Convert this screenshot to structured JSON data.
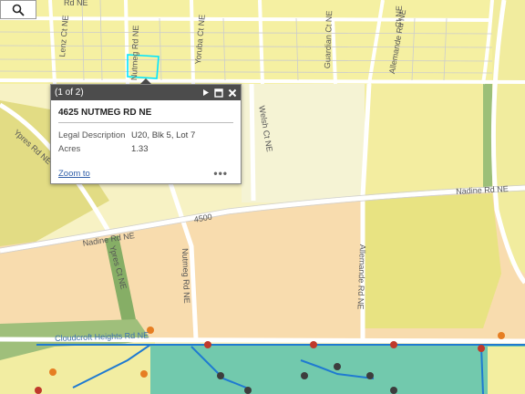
{
  "popup": {
    "counter": "(1 of 2)",
    "title": "4625 NUTMEG RD NE",
    "attributes": [
      {
        "label": "Legal Description",
        "value": "U20, Blk 5, Lot 7"
      },
      {
        "label": "Acres",
        "value": "1.33"
      }
    ],
    "zoom_label": "Zoom to",
    "more_label": "•••"
  },
  "map": {
    "road_labels": {
      "lenz": "Lenz Ct NE",
      "nutmeg_top": "Nutmeg Rd NE",
      "yoruba": "Yoruba Ct NE",
      "guardian": "Guardian Ct NE",
      "allemande_top": "Allemande Rd NE",
      "top_ne": "Rd NE",
      "top_right": "Ct NE",
      "yrpes_rd": "Ypres Rd NE",
      "welsh": "Welsh Ct NE",
      "nadine_right": "Nadine Rd NE",
      "nadine_left": "Nadine Rd NE",
      "nutmeg": "Nutmeg Rd NE",
      "allemande": "Allemande Rd NE",
      "ypres_ct": "Ypres Ct NE",
      "address_4500": "4500",
      "bottom_road": "Cloudcroft Heights Rd NE"
    }
  },
  "colors": {
    "residential_yellow": "#f5f0a8",
    "open_yellow": "#f5f3d0",
    "olive_yellow": "#e6e17e",
    "tan_commercial": "#f8ddb0",
    "green_open": "#a3c07a",
    "park_teal": "#6cc6ac",
    "road": "#ffffff",
    "parcel_line": "#c8c8c8",
    "highlight": "#00e5ff",
    "blue_line": "#1f7ad1"
  }
}
